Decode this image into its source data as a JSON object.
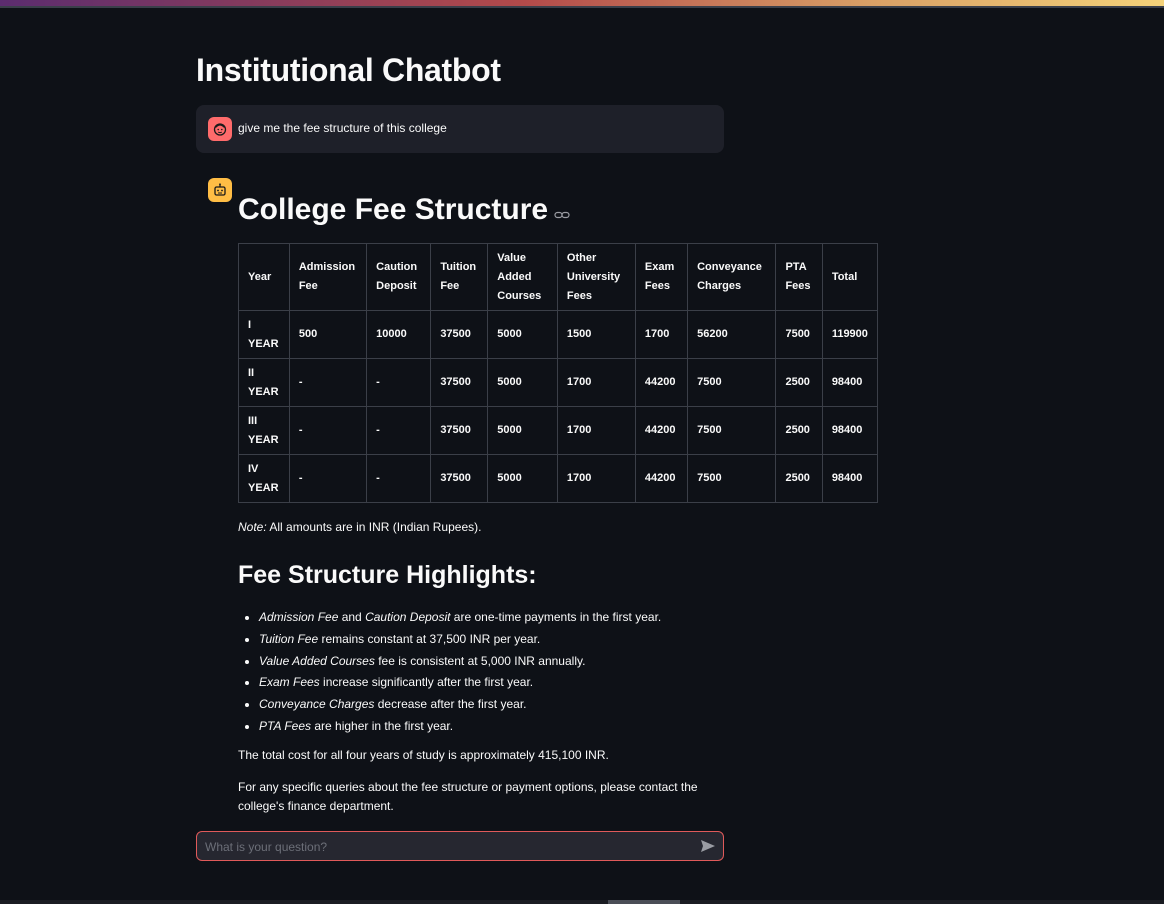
{
  "app": {
    "title": "Institutional Chatbot"
  },
  "user_message": {
    "text": "give me the fee structure of this college"
  },
  "assistant": {
    "heading": "College Fee Structure",
    "table": {
      "headers": [
        "Year",
        "Admission Fee",
        "Caution Deposit",
        "Tuition Fee",
        "Value Added Courses",
        "Other University Fees",
        "Exam Fees",
        "Conveyance Charges",
        "PTA Fees",
        "Total"
      ],
      "rows": [
        [
          "I YEAR",
          "500",
          "10000",
          "37500",
          "5000",
          "1500",
          "1700",
          "56200",
          "7500",
          "119900"
        ],
        [
          "II YEAR",
          "-",
          "-",
          "37500",
          "5000",
          "1700",
          "44200",
          "7500",
          "2500",
          "98400"
        ],
        [
          "III YEAR",
          "-",
          "-",
          "37500",
          "5000",
          "1700",
          "44200",
          "7500",
          "2500",
          "98400"
        ],
        [
          "IV YEAR",
          "-",
          "-",
          "37500",
          "5000",
          "1700",
          "44200",
          "7500",
          "2500",
          "98400"
        ]
      ]
    },
    "note_label": "Note:",
    "note_text": " All amounts are in INR (Indian Rupees).",
    "highlights_heading": "Fee Structure Highlights:",
    "highlights": [
      {
        "em1": "Admission Fee",
        "mid": " and ",
        "em2": "Caution Deposit",
        "rest": " are one-time payments in the first year."
      },
      {
        "em1": "Tuition Fee",
        "mid": "",
        "em2": "",
        "rest": " remains constant at 37,500 INR per year."
      },
      {
        "em1": "Value Added Courses",
        "mid": "",
        "em2": "",
        "rest": " fee is consistent at 5,000 INR annually."
      },
      {
        "em1": "Exam Fees",
        "mid": "",
        "em2": "",
        "rest": " increase significantly after the first year."
      },
      {
        "em1": "Conveyance Charges",
        "mid": "",
        "em2": "",
        "rest": " decrease after the first year."
      },
      {
        "em1": "PTA Fees",
        "mid": "",
        "em2": "",
        "rest": " are higher in the first year."
      }
    ],
    "total_paragraph": "The total cost for all four years of study is approximately 415,100 INR.",
    "contact_paragraph": "For any specific queries about the fee structure or payment options, please contact the college's finance department."
  },
  "chat_input": {
    "placeholder": "What is your question?",
    "value": ""
  },
  "icons": {
    "user_avatar": "user-face-icon",
    "bot_avatar": "robot-icon",
    "anchor": "link-icon",
    "send": "send-icon"
  },
  "colors": {
    "background": "#0e1117",
    "user_avatar": "#ff6b6b",
    "bot_avatar": "#ffbd45",
    "input_border": "#e05a5a"
  }
}
